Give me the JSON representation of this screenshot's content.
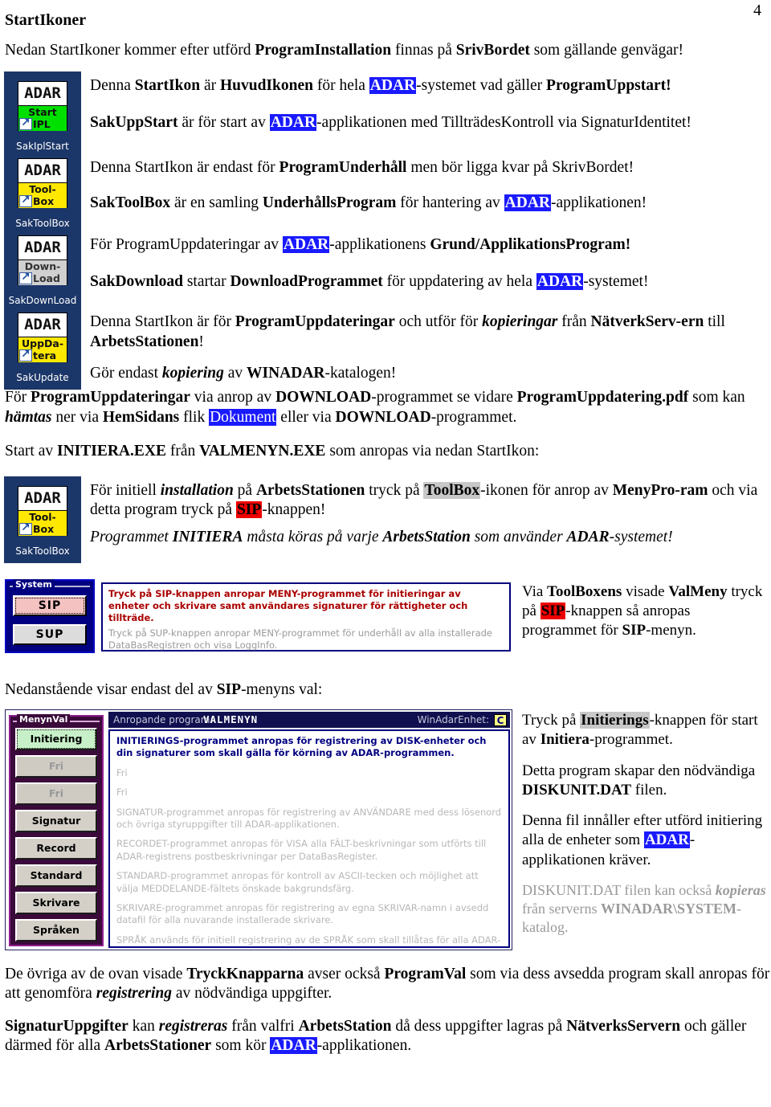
{
  "page": {
    "number": "4",
    "title": "StartIkoner"
  },
  "intro": {
    "line": "Nedan StartIkoner kommer efter utförd ProgramInstallation finnas på SrivBordet som gällande genvägar!",
    "b1": "ProgramInstallation",
    "b2": "SrivBordet",
    "pre": "Nedan StartIkoner kommer efter utförd ",
    "mid": " finnas på ",
    "post": " som gällande genvägar!"
  },
  "icons": [
    {
      "name": "SakIplStart",
      "adar": "ADAR",
      "line1": "Start",
      "line2": "IPL",
      "band": "green"
    },
    {
      "name": "SakToolBox",
      "adar": "ADAR",
      "line1": "Tool-",
      "line2": "Box",
      "band": "yellow"
    },
    {
      "name": "SakDownLoad",
      "adar": "ADAR",
      "line1": "Down-",
      "line2": "Load",
      "band": "gray"
    },
    {
      "name": "SakUpdate",
      "adar": "ADAR",
      "line1": "UppDa-",
      "line2": "tera",
      "band": "yellow"
    }
  ],
  "icon_paragraphs": [
    {
      "id": "p-huvudikon",
      "parts": [
        {
          "t": "Denna ",
          "s": "n"
        },
        {
          "t": "StartIkon",
          "s": "b"
        },
        {
          "t": " är ",
          "s": "n"
        },
        {
          "t": "HuvudIkonen",
          "s": "b"
        },
        {
          "t": " för hela ",
          "s": "n"
        },
        {
          "t": "ADAR",
          "s": "hl-blue"
        },
        {
          "t": "-systemet vad gäller ",
          "s": "n"
        },
        {
          "t": "ProgramUppstart!",
          "s": "b"
        }
      ]
    },
    {
      "id": "p-sakuppstart",
      "parts": [
        {
          "t": "SakUppStart",
          "s": "b"
        },
        {
          "t": " är för start av ",
          "s": "n"
        },
        {
          "t": "ADAR",
          "s": "hl-blue"
        },
        {
          "t": "-applikationen med TillträdesKontroll via SignaturIdentitet!",
          "s": "n"
        }
      ]
    },
    {
      "id": "p-programunderhall",
      "parts": [
        {
          "t": "Denna StartIkon är endast för ",
          "s": "n"
        },
        {
          "t": "ProgramUnderhåll",
          "s": "b"
        },
        {
          "t": " men bör ligga kvar på SkrivBordet!",
          "s": "n"
        }
      ]
    },
    {
      "id": "p-saktoolbox",
      "parts": [
        {
          "t": "SakToolBox",
          "s": "b"
        },
        {
          "t": " är en samling ",
          "s": "n"
        },
        {
          "t": "UnderhållsProgram",
          "s": "b"
        },
        {
          "t": " för hantering av ",
          "s": "n"
        },
        {
          "t": "ADAR",
          "s": "hl-blue"
        },
        {
          "t": "-applikationen!",
          "s": "n"
        }
      ]
    },
    {
      "id": "p-programuppdateringar",
      "parts": [
        {
          "t": "För ProgramUppdateringar av ",
          "s": "n"
        },
        {
          "t": "ADAR",
          "s": "hl-blue"
        },
        {
          "t": "-applikationens ",
          "s": "n"
        },
        {
          "t": "Grund/ApplikationsProgram!",
          "s": "b"
        }
      ]
    },
    {
      "id": "p-sakdownload",
      "parts": [
        {
          "t": "SakDownload",
          "s": "b"
        },
        {
          "t": " startar ",
          "s": "n"
        },
        {
          "t": "DownloadProgrammet",
          "s": "b"
        },
        {
          "t": " för uppdatering av hela ",
          "s": "n"
        },
        {
          "t": "ADAR",
          "s": "hl-blue"
        },
        {
          "t": "-systemet!",
          "s": "n"
        }
      ]
    },
    {
      "id": "p-sakupdate",
      "parts": [
        {
          "t": "Denna StartIkon är för ",
          "s": "n"
        },
        {
          "t": "ProgramUppdateringar",
          "s": "b"
        },
        {
          "t": " och utför för ",
          "s": "n"
        },
        {
          "t": "kopieringar",
          "s": "bi"
        },
        {
          "t": " från ",
          "s": "n"
        },
        {
          "t": "NätverkServ-ern",
          "s": "b"
        },
        {
          "t": " till ",
          "s": "n"
        },
        {
          "t": "ArbetsStationen",
          "s": "b"
        },
        {
          "t": "!",
          "s": "n"
        }
      ]
    },
    {
      "id": "p-kopiering",
      "parts": [
        {
          "t": "Gör endast ",
          "s": "n"
        },
        {
          "t": "kopiering",
          "s": "bi"
        },
        {
          "t": " av ",
          "s": "n"
        },
        {
          "t": "WINADAR",
          "s": "b"
        },
        {
          "t": "-katalogen!",
          "s": "n"
        }
      ]
    }
  ],
  "mid_paragraphs": [
    {
      "id": "p-pdf",
      "parts": [
        {
          "t": "För ",
          "s": "n"
        },
        {
          "t": "ProgramUppdateringar",
          "s": "b"
        },
        {
          "t": " via anrop av ",
          "s": "n"
        },
        {
          "t": "DOWNLOAD",
          "s": "b"
        },
        {
          "t": "-programmet se vidare ",
          "s": "n"
        },
        {
          "t": "ProgramUppdatering.pdf",
          "s": "b"
        },
        {
          "t": " som kan ",
          "s": "n"
        },
        {
          "t": "hämtas",
          "s": "bi"
        },
        {
          "t": " ner via ",
          "s": "n"
        },
        {
          "t": "HemSidans",
          "s": "b"
        },
        {
          "t": " flik ",
          "s": "n"
        },
        {
          "t": "Dokument",
          "s": "hl-blue-plain"
        },
        {
          "t": " eller via ",
          "s": "n"
        },
        {
          "t": "DOWNLOAD",
          "s": "b"
        },
        {
          "t": "-programmet.",
          "s": "n"
        }
      ]
    },
    {
      "id": "p-initiera",
      "parts": [
        {
          "t": "Start av ",
          "s": "n"
        },
        {
          "t": "INITIERA.EXE",
          "s": "b"
        },
        {
          "t": " från ",
          "s": "n"
        },
        {
          "t": "VALMENYN.EXE",
          "s": "b"
        },
        {
          "t": " som anropas via nedan StartIkon:",
          "s": "n"
        }
      ]
    }
  ],
  "toolbox_block": {
    "icon": {
      "name": "SakToolBox",
      "adar": "ADAR",
      "line1": "Tool-",
      "line2": "Box",
      "band": "yellow"
    },
    "paragraphs": [
      {
        "id": "p-initiell",
        "parts": [
          {
            "t": "För initiell ",
            "s": "n"
          },
          {
            "t": "installation",
            "s": "bi"
          },
          {
            "t": " på ",
            "s": "n"
          },
          {
            "t": "ArbetsStationen",
            "s": "b"
          },
          {
            "t": " tryck på ",
            "s": "n"
          },
          {
            "t": "ToolBox",
            "s": "hl-gray"
          },
          {
            "t": "-ikonen för anrop av  ",
            "s": "n"
          },
          {
            "t": "MenyPro-ram",
            "s": "b"
          },
          {
            "t": " och via detta program tryck på ",
            "s": "n"
          },
          {
            "t": "SIP",
            "s": "hl-red"
          },
          {
            "t": "-knappen!",
            "s": "n"
          }
        ]
      },
      {
        "id": "p-initiera-kors",
        "parts": [
          {
            "t": "Programmet ",
            "s": "i"
          },
          {
            "t": "INITIERA",
            "s": "bi"
          },
          {
            "t": " måsta köras på varje ",
            "s": "i"
          },
          {
            "t": "ArbetsStation",
            "s": "bi"
          },
          {
            "t": " som använder ",
            "s": "i"
          },
          {
            "t": "ADAR",
            "s": "bi"
          },
          {
            "t": "-systemet!",
            "s": "i"
          }
        ]
      }
    ]
  },
  "sip_panel": {
    "group_legend": "System",
    "buttons": [
      {
        "label": "SIP",
        "underline": "I",
        "state": "focused"
      },
      {
        "label": "SUP",
        "underline": "U",
        "state": "normal"
      }
    ],
    "text_red": "Tryck på SIP-knappen anropar MENY-programmet för initieringar av enheter och skrivare samt användares signaturer för rättigheter och tillträde.",
    "text_gray": "Tryck på SUP-knappen anropar MENY-programmet för underhåll av alla installerade DataBasRegistren och visa LoggInfo."
  },
  "sip_side": {
    "parts": [
      {
        "t": "Via ",
        "s": "n"
      },
      {
        "t": "ToolBoxens",
        "s": "b"
      },
      {
        "t": " visade ",
        "s": "n"
      },
      {
        "t": "ValMeny",
        "s": "b"
      },
      {
        "t": " tryck på ",
        "s": "n"
      },
      {
        "t": "SIP",
        "s": "hl-red"
      },
      {
        "t": "-knappen så anropas programmet för ",
        "s": "n"
      },
      {
        "t": "SIP",
        "s": "b"
      },
      {
        "t": "-menyn.",
        "s": "n"
      }
    ]
  },
  "sip_menu_note": {
    "parts": [
      {
        "t": "Nedanstående visar endast del av ",
        "s": "n"
      },
      {
        "t": "SIP",
        "s": "b"
      },
      {
        "t": "-menyns val:",
        "s": "n"
      }
    ]
  },
  "meny_panel": {
    "group_legend": "MenynVal",
    "header": {
      "label": "Anropande program:",
      "value": "VALMENYN",
      "unit_label": "WinAdarEnhet:",
      "unit_value": "C"
    },
    "buttons": [
      {
        "label": "Initiering",
        "underline": "I",
        "state": "active"
      },
      {
        "label": "Fri",
        "underline": "F",
        "state": "disabled"
      },
      {
        "label": "Fri",
        "underline": "",
        "state": "disabled"
      },
      {
        "label": "Signatur",
        "underline": "S",
        "state": "normal"
      },
      {
        "label": "Record",
        "underline": "R",
        "state": "normal"
      },
      {
        "label": "Standard",
        "underline": "d",
        "state": "normal"
      },
      {
        "label": "Skrivare",
        "underline": "v",
        "state": "normal"
      },
      {
        "label": "Språken",
        "underline": "å",
        "state": "normal"
      }
    ],
    "rows": [
      {
        "style": "strong",
        "text": "INITIERINGS-programmet anropas för registrering av DISK-enheter och din signaturer som skall gälla för körning av ADAR-programmen."
      },
      {
        "style": "faded",
        "text": "Fri"
      },
      {
        "style": "faded",
        "text": "Fri"
      },
      {
        "style": "faded",
        "text": "SIGNATUR-programmet anropas för registrering av ANVÄNDARE med dess lösenord och övriga styruppgifter till ADAR-applikationen."
      },
      {
        "style": "faded",
        "text": "RECORDET-programmet anropas för VISA alla FÄLT-beskrivningar som utförts till ADAR-registrens postbeskrivningar per DataBasRegister."
      },
      {
        "style": "faded",
        "text": "STANDARD-programmet anropas för kontroll av ASCII-tecken och möjlighet att välja MEDDELANDE-fältets önskade bakgrundsfärg."
      },
      {
        "style": "faded",
        "text": "SKRIVARE-programmet anropas för registrering av egna SKRIVAR-namn i avsedd datafil för alla nuvarande installerade skrivare."
      },
      {
        "style": "faded",
        "text": "SPRÅK används för initiell registrering av de SPRÅK som skall tillåtas för alla ADAR-applikationens ingående program."
      }
    ]
  },
  "meny_side": [
    {
      "id": "p-initierings",
      "parts": [
        {
          "t": "Tryck på ",
          "s": "n"
        },
        {
          "t": "Initierings",
          "s": "hl-gray"
        },
        {
          "t": "-knappen för start av ",
          "s": "n"
        },
        {
          "t": "Initiera",
          "s": "b"
        },
        {
          "t": "-programmet.",
          "s": "n"
        }
      ]
    },
    {
      "id": "p-diskunit",
      "parts": [
        {
          "t": "Detta program skapar den nödvändiga ",
          "s": "n"
        },
        {
          "t": "DISKUNIT.DAT",
          "s": "b"
        },
        {
          "t": " filen.",
          "s": "n"
        }
      ]
    },
    {
      "id": "p-fil",
      "parts": [
        {
          "t": "Denna fil innåller efter utförd initiering alla de enheter som ",
          "s": "n"
        },
        {
          "t": "ADAR",
          "s": "hl-blue"
        },
        {
          "t": "-applikationen kräver.",
          "s": "n"
        }
      ]
    },
    {
      "id": "p-diskunit-dim",
      "dim": true,
      "parts": [
        {
          "t": "DISKUNIT.DAT filen kan också ",
          "s": "n"
        },
        {
          "t": "kopieras",
          "s": "bi"
        },
        {
          "t": " från serverns ",
          "s": "n"
        },
        {
          "t": "WINADAR\\SYSTEM",
          "s": "b"
        },
        {
          "t": "-katalog.",
          "s": "n"
        }
      ]
    }
  ],
  "tail_paragraphs": [
    {
      "id": "p-tryckknappar",
      "parts": [
        {
          "t": "De övriga av de ovan visade ",
          "s": "n"
        },
        {
          "t": "TryckKnapparna",
          "s": "b"
        },
        {
          "t": " avser också ",
          "s": "n"
        },
        {
          "t": "ProgramVal",
          "s": "b"
        },
        {
          "t": " som via dess avsedda program skall anropas för att genomföra ",
          "s": "n"
        },
        {
          "t": "registrering",
          "s": "bi"
        },
        {
          "t": " av nödvändiga uppgifter.",
          "s": "n"
        }
      ]
    },
    {
      "id": "p-signaturuppgifter",
      "parts": [
        {
          "t": "SignaturUppgifter",
          "s": "b"
        },
        {
          "t": " kan ",
          "s": "n"
        },
        {
          "t": "registreras",
          "s": "bi"
        },
        {
          "t": " från valfri ",
          "s": "n"
        },
        {
          "t": "ArbetsStation",
          "s": "b"
        },
        {
          "t": " då dess uppgifter lagras på  ",
          "s": "n"
        },
        {
          "t": "NätverksServern",
          "s": "b"
        },
        {
          "t": " och gäller därmed för alla ",
          "s": "n"
        },
        {
          "t": "ArbetsStationer",
          "s": "b"
        },
        {
          "t": " som kör ",
          "s": "n"
        },
        {
          "t": "ADAR",
          "s": "hl-blue"
        },
        {
          "t": "-applikationen.",
          "s": "n"
        }
      ]
    }
  ],
  "colors": {
    "highlight_blue": "#1a1aff",
    "highlight_red": "#ee0000",
    "highlight_gray": "#c8c8c8",
    "icon_panel_bg": "#1b3668",
    "sip_group_bg": "#000080",
    "meny_group_bg": "#3a0a3a",
    "meny_group_border": "#8e1f8e",
    "sip_text_red": "#aa0000",
    "meny_header_bg": "#101050"
  }
}
